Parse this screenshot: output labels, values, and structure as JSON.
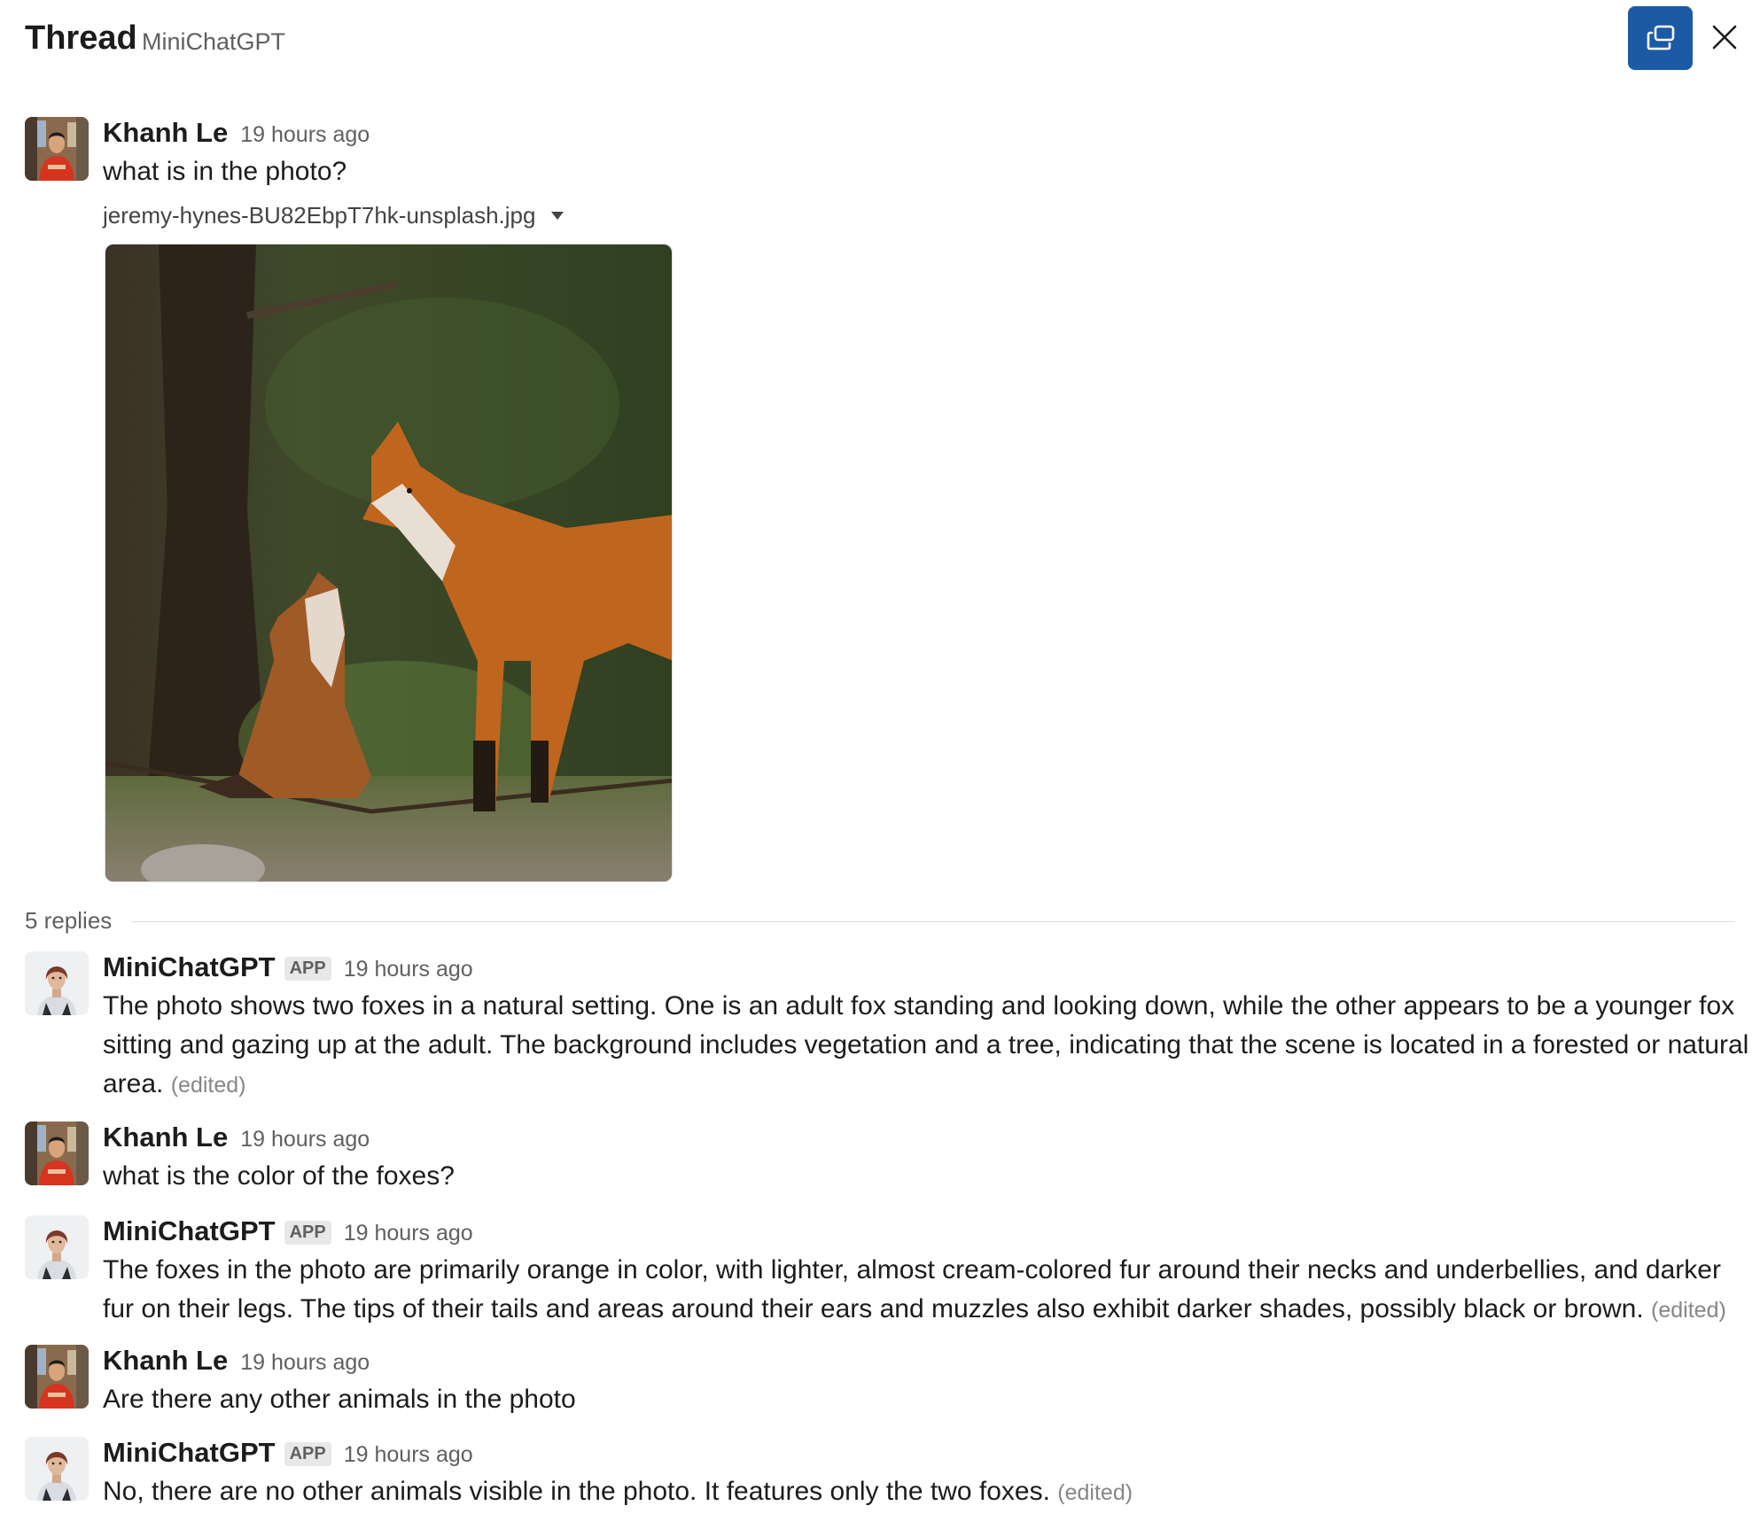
{
  "header": {
    "title": "Thread",
    "channel": "MiniChatGPT",
    "open_icon": "open-in-window-icon",
    "close_icon": "close-icon"
  },
  "root_message": {
    "author": "Khanh Le",
    "time": "19 hours ago",
    "text": "what is in the photo?",
    "file": {
      "name": "jeremy-hynes-BU82EbpT7hk-unsplash.jpg",
      "icon": "caret-down-icon"
    }
  },
  "replies": {
    "label": "5 replies",
    "messages": [
      {
        "author": "MiniChatGPT",
        "badge": "APP",
        "time": "19 hours ago",
        "text": "The photo shows two foxes in a natural setting. One is an adult fox standing and looking down, while the other appears to be a younger fox sitting and gazing up at the adult. The background includes vegetation and a tree, indicating that the scene is located in a forested or natural area.",
        "edited": "(edited)"
      },
      {
        "author": "Khanh Le",
        "time": "19 hours ago",
        "text": "what is the color of the foxes?"
      },
      {
        "author": "MiniChatGPT",
        "badge": "APP",
        "time": "19 hours ago",
        "text": "The foxes in the photo are primarily orange in color, with lighter, almost cream-colored fur around their necks and underbellies, and darker fur on their legs. The tips of their tails and areas around their ears and muzzles also exhibit darker shades, possibly black or brown.",
        "edited": "(edited)"
      },
      {
        "author": "Khanh Le",
        "time": "19 hours ago",
        "text": "Are there any other animals in the photo"
      },
      {
        "author": "MiniChatGPT",
        "badge": "APP",
        "time": "19 hours ago",
        "text": "No, there are no other animals visible in the photo. It features only the two foxes.",
        "edited": "(edited)"
      }
    ]
  },
  "colors": {
    "accent": "#1d5aa6",
    "text": "#1d1c1d",
    "muted": "#616061"
  }
}
